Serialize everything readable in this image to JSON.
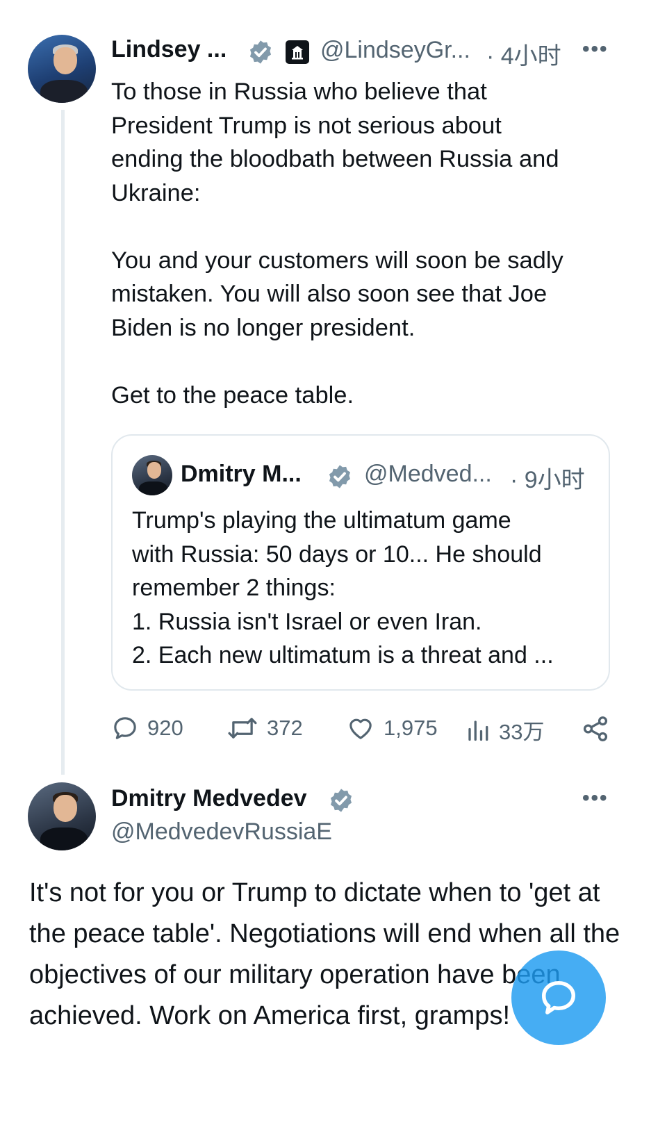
{
  "colors": {
    "accent": "#1d9bf0",
    "text": "#0f1419",
    "muted": "#536471",
    "border": "#e1e8ed"
  },
  "main_tweet": {
    "author_name": "Lindsey ...",
    "handle": "@LindseyGr...",
    "time": "· 4小时",
    "more_icon": "more-dots-icon",
    "text": "To those in Russia who believe that\nPresident Trump is not serious about\nending the bloodbath between Russia and\nUkraine:\n\nYou and your customers will soon be sadly\nmistaken. You will also soon see that Joe\nBiden is no longer president.\n\nGet to the peace table."
  },
  "quoted_tweet": {
    "author_name": "Dmitry M...",
    "handle": "@Medved...",
    "time": "· 9小时",
    "text": "Trump's playing the ultimatum game\nwith Russia: 50 days or 10... He should\nremember 2 things:\n1. Russia isn't Israel or even Iran.\n2. Each new ultimatum is a threat and ..."
  },
  "actions": {
    "replies": "920",
    "retweets": "372",
    "likes": "1,975",
    "views": "33万"
  },
  "reply_tweet": {
    "author_name": "Dmitry Medvedev",
    "handle": "@MedvedevRussiaE",
    "text": "It's not for you or Trump to dictate when to 'get at the peace table'. Negotiations will end when all the objectives of our military operation have been achieved. Work on America first, gramps!"
  },
  "fab": {
    "icon": "compose-reply-icon"
  }
}
